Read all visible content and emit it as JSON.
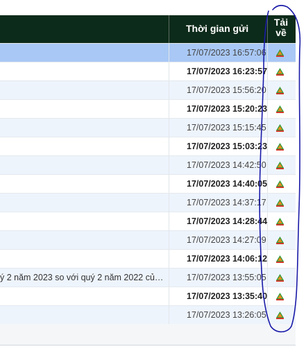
{
  "table": {
    "header": {
      "time_label": "Thời gian gửi",
      "download_label_line1": "Tải",
      "download_label_line2": "về"
    },
    "rows": [
      {
        "name": "",
        "time": "17/07/2023 16:57:06",
        "bold": false,
        "selected": true
      },
      {
        "name": "",
        "time": "17/07/2023 16:23:57",
        "bold": true,
        "selected": false
      },
      {
        "name": "",
        "time": "17/07/2023 15:56:20",
        "bold": false,
        "selected": false
      },
      {
        "name": "",
        "time": "17/07/2023 15:20:23",
        "bold": true,
        "selected": false
      },
      {
        "name": "",
        "time": "17/07/2023 15:15:45",
        "bold": false,
        "selected": false
      },
      {
        "name": "",
        "time": "17/07/2023 15:03:23",
        "bold": true,
        "selected": false
      },
      {
        "name": "",
        "time": "17/07/2023 14:42:50",
        "bold": false,
        "selected": false
      },
      {
        "name": "",
        "time": "17/07/2023 14:40:05",
        "bold": true,
        "selected": false
      },
      {
        "name": "",
        "time": "17/07/2023 14:37:17",
        "bold": false,
        "selected": false
      },
      {
        "name": "",
        "time": "17/07/2023 14:28:44",
        "bold": true,
        "selected": false
      },
      {
        "name": "",
        "time": "17/07/2023 14:27:09",
        "bold": false,
        "selected": false
      },
      {
        "name": "",
        "time": "17/07/2023 14:06:12",
        "bold": true,
        "selected": false
      },
      {
        "name": "ý 2 năm 2023 so với quý 2 năm 2022 của …",
        "time": "17/07/2023 13:55:05",
        "bold": false,
        "selected": false
      },
      {
        "name": "",
        "time": "17/07/2023 13:35:40",
        "bold": true,
        "selected": false
      },
      {
        "name": "",
        "time": "17/07/2023 13:26:05",
        "bold": false,
        "selected": false
      }
    ]
  },
  "icons": {
    "download": "download-icon"
  },
  "colors": {
    "header_bg": "#0d2b1a",
    "selected_row": "#a9c8f5",
    "alt_row": "#eef4fc",
    "annotation": "#1a1aa8"
  }
}
